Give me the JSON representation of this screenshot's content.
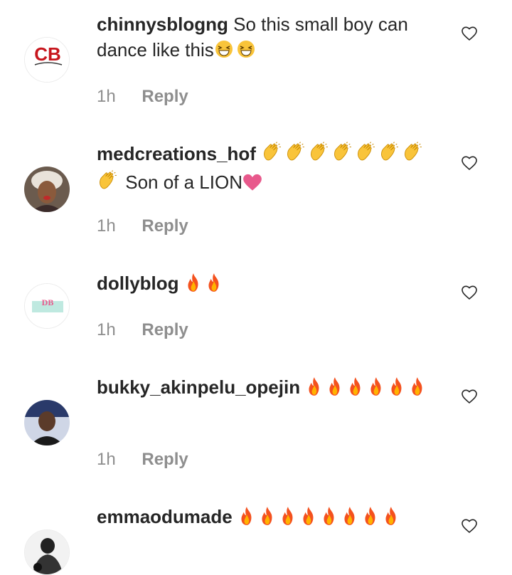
{
  "comments": [
    {
      "username": "chinnysblogng",
      "text": "So this small boy can dance like this",
      "emojis": [
        "grin-squint-emoji",
        "grin-squint-emoji"
      ],
      "time": "1h",
      "reply_label": "Reply",
      "avatar_logo": "CB"
    },
    {
      "username": "medcreations_hof",
      "text_prefix": "",
      "emojis": [
        "clap-emoji",
        "clap-emoji",
        "clap-emoji",
        "clap-emoji",
        "clap-emoji",
        "clap-emoji",
        "clap-emoji",
        "clap-emoji"
      ],
      "text": "Son of a LION",
      "trailing_emoji": "heart-emoji",
      "time": "1h",
      "reply_label": "Reply"
    },
    {
      "username": "dollyblog",
      "emojis": [
        "fire-emoji",
        "fire-emoji"
      ],
      "time": "1h",
      "reply_label": "Reply",
      "avatar_logo": "DB"
    },
    {
      "username": "bukky_akinpelu_opejin",
      "emojis": [
        "fire-emoji",
        "fire-emoji",
        "fire-emoji",
        "fire-emoji",
        "fire-emoji",
        "fire-emoji"
      ],
      "time": "1h",
      "reply_label": "Reply"
    },
    {
      "username": "emmaodumade",
      "emojis": [
        "fire-emoji",
        "fire-emoji",
        "fire-emoji",
        "fire-emoji",
        "fire-emoji",
        "fire-emoji",
        "fire-emoji",
        "fire-emoji"
      ]
    }
  ],
  "colors": {
    "text": "#262626",
    "meta": "#8e8e8e",
    "fire": "#f4511e",
    "clap": "#f9c43a",
    "heart": "#e8598c"
  }
}
